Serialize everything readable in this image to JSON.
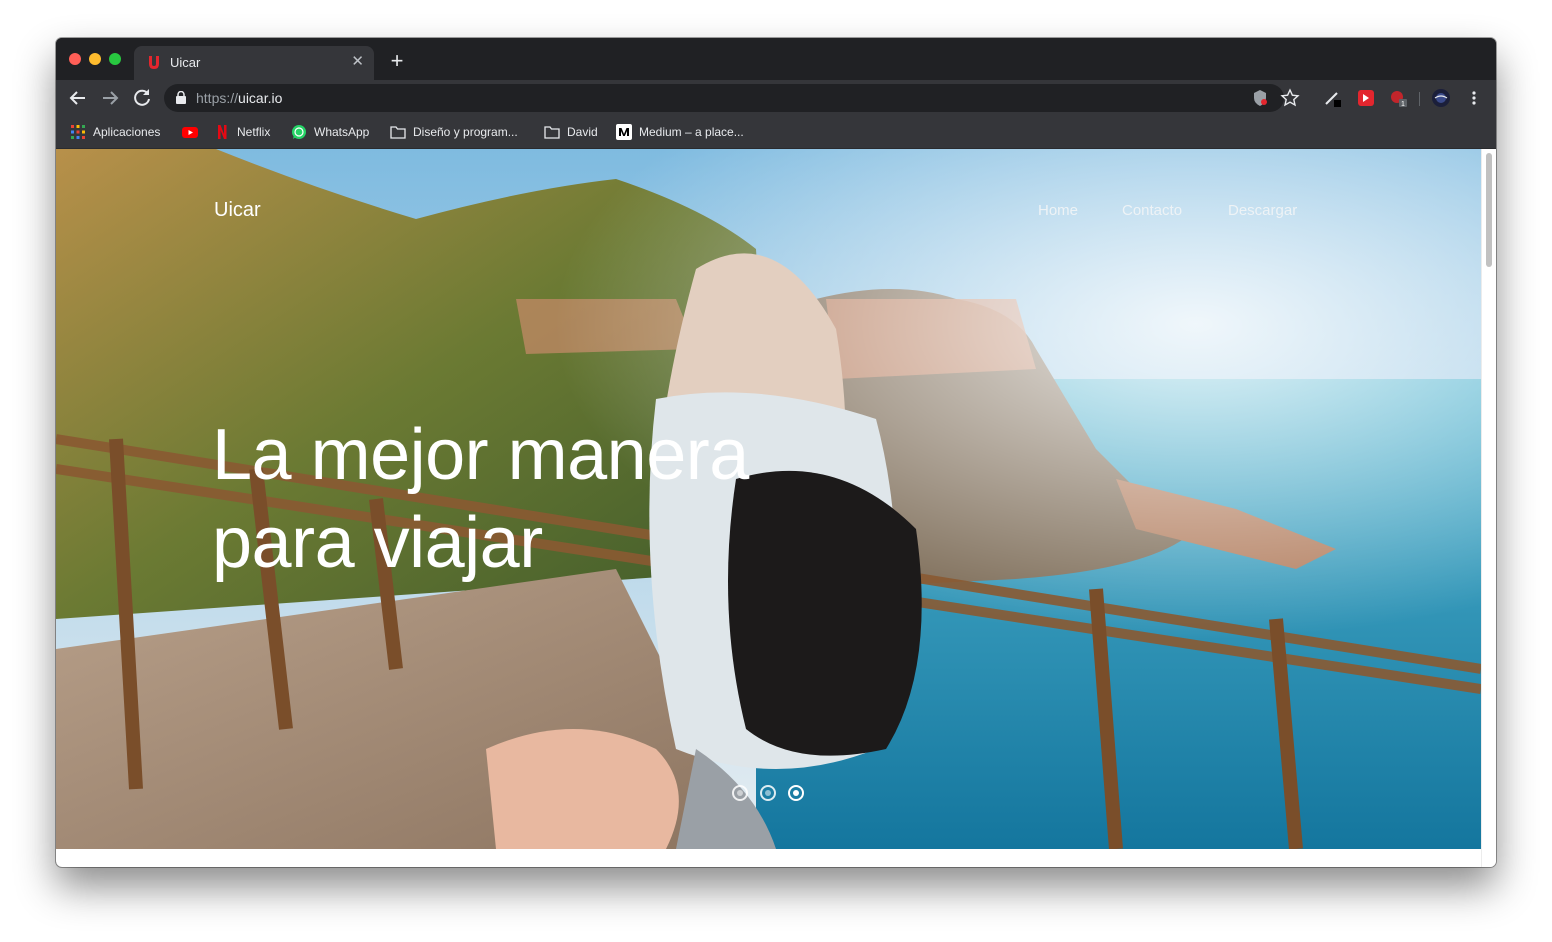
{
  "browser": {
    "tab": {
      "title": "Uicar",
      "close_glyph": "✕"
    },
    "new_tab_glyph": "+",
    "url_scheme": "https://",
    "url_host": "uicar.io",
    "ext_badge": "1",
    "bookmarks": [
      {
        "label": "Aplicaciones",
        "icon": "apps-grid-icon"
      },
      {
        "label": "",
        "icon": "youtube-icon"
      },
      {
        "label": "Netflix",
        "icon": "netflix-icon"
      },
      {
        "label": "WhatsApp",
        "icon": "whatsapp-icon"
      },
      {
        "label": "Diseño y program...",
        "icon": "folder-icon"
      },
      {
        "label": "David",
        "icon": "folder-icon"
      },
      {
        "label": "Medium – a place...",
        "icon": "medium-icon"
      }
    ]
  },
  "site": {
    "brand": "Uicar",
    "nav": [
      "Home",
      "Contacto",
      "Descargar"
    ],
    "headline_line1": "La mejor manera",
    "headline_line2": "para viajar",
    "carousel": {
      "slides": 3,
      "active_index": 2
    }
  },
  "colors": {
    "brand_red": "#e3262e",
    "chrome_dark": "#202124",
    "chrome_toolbar": "#35363a"
  }
}
